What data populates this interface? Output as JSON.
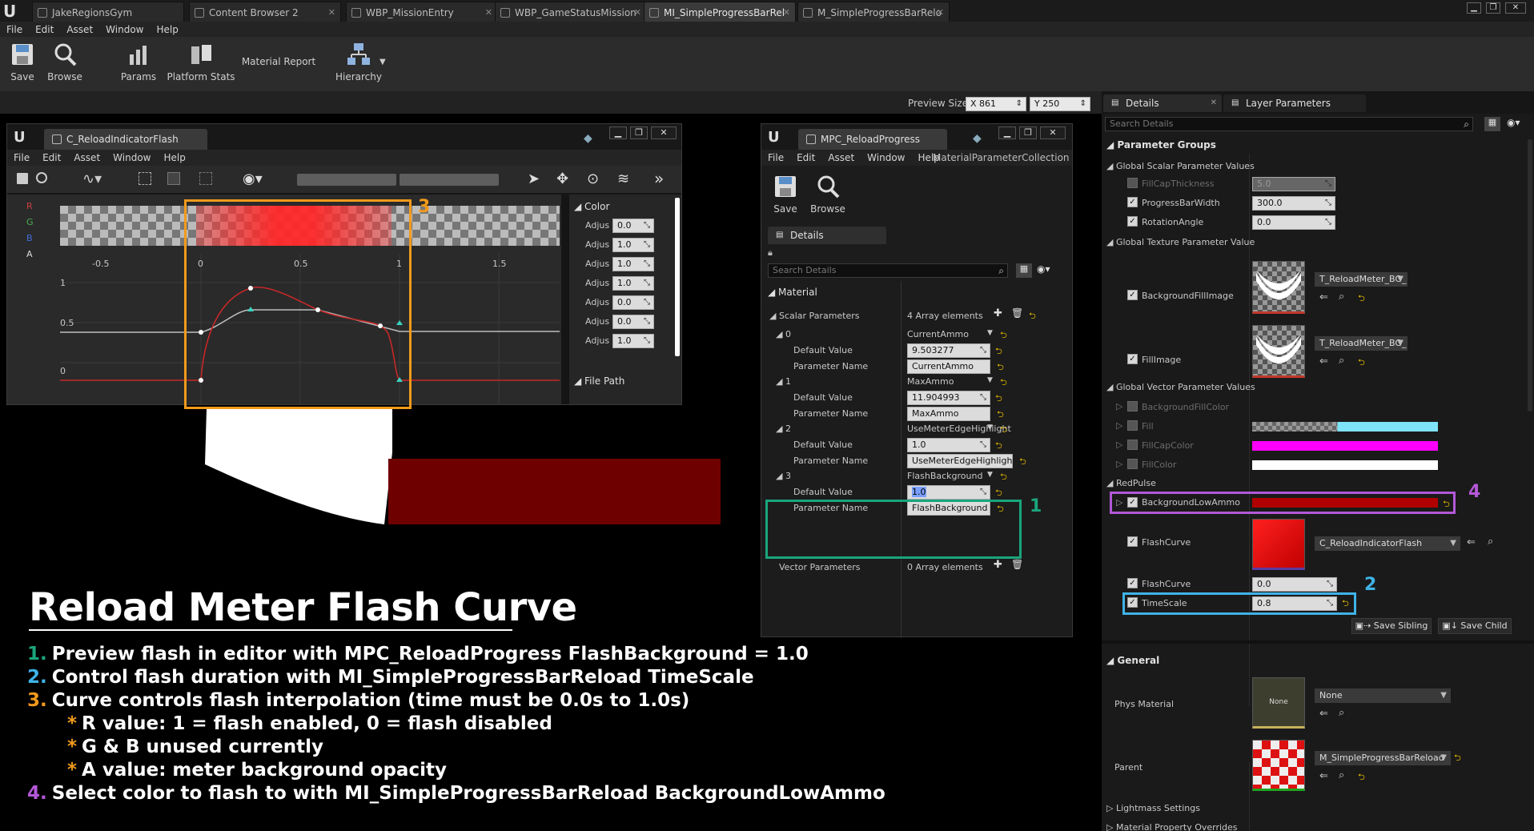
{
  "colors": {
    "teal": "#1aa57c",
    "blue": "#3fb3e8",
    "orange": "#f29a1c",
    "purple": "#b358d8"
  },
  "tabs": [
    {
      "label": "JakeRegionsGym"
    },
    {
      "label": "Content Browser 2"
    },
    {
      "label": "WBP_MissionEntry"
    },
    {
      "label": "WBP_GameStatusMission"
    },
    {
      "label": "MI_SimpleProgressBarRel"
    },
    {
      "label": "M_SimpleProgressBarRelo"
    }
  ],
  "menu": [
    "File",
    "Edit",
    "Asset",
    "Window",
    "Help"
  ],
  "toolbar": {
    "save": "Save",
    "browse": "Browse",
    "params": "Params",
    "platform_stats": "Platform Stats",
    "material_report": "Material Report",
    "hierarchy": "Hierarchy"
  },
  "preview": {
    "label": "Preview Size",
    "x_label": "X",
    "x": "861",
    "y_label": "Y",
    "y": "250"
  },
  "curve_window": {
    "tab": "C_ReloadIndicatorFlash",
    "menu": [
      "File",
      "Edit",
      "Asset",
      "Window",
      "Help"
    ],
    "channels": [
      "R",
      "G",
      "B",
      "A"
    ],
    "ticks": [
      "-0.5",
      "0",
      "0.5",
      "1",
      "1.5"
    ],
    "yticks": [
      "1",
      "0.5",
      "0"
    ],
    "color_header": "Color",
    "adjust_label": "Adjus",
    "adjust_values": [
      "0.0",
      "1.0",
      "1.0",
      "1.0",
      "0.0",
      "0.0",
      "1.0"
    ],
    "file_path": "File Path"
  },
  "mpc_window": {
    "tab": "MPC_ReloadProgress",
    "menu": [
      "File",
      "Edit",
      "Asset",
      "Window",
      "Help"
    ],
    "parent_class": "MaterialParameterCollection",
    "save": "Save",
    "browse": "Browse",
    "details_tab": "Details",
    "search_placeholder": "Search Details",
    "section": "Material",
    "scalar_label": "Scalar Parameters",
    "scalar_count": "4 Array elements",
    "params": [
      {
        "idx": "0",
        "name": "CurrentAmmo",
        "default": "9.503277",
        "pname": "CurrentAmmo"
      },
      {
        "idx": "1",
        "name": "MaxAmmo",
        "default": "11.904993",
        "pname": "MaxAmmo"
      },
      {
        "idx": "2",
        "name": "UseMeterEdgeHighlight",
        "default": "1.0",
        "pname": "UseMeterEdgeHighlight"
      },
      {
        "idx": "3",
        "name": "FlashBackground",
        "default": "1.0",
        "pname": "FlashBackground"
      }
    ],
    "default_label": "Default Value",
    "pname_label": "Parameter Name",
    "vector_label": "Vector Parameters",
    "vector_count": "0 Array elements"
  },
  "details": {
    "tab1": "Details",
    "tab2": "Layer Parameters",
    "search_placeholder": "Search Details",
    "param_groups": "Parameter Groups",
    "global_scalar": "Global Scalar Parameter Values",
    "scalars": [
      {
        "name": "FillCapThickness",
        "value": "5.0",
        "checked": false
      },
      {
        "name": "ProgressBarWidth",
        "value": "300.0",
        "checked": true
      },
      {
        "name": "RotationAngle",
        "value": "0.0",
        "checked": true
      }
    ],
    "global_texture": "Global Texture Parameter Value",
    "textures": [
      {
        "name": "BackgroundFillImage",
        "asset": "T_ReloadMeter_BG_I"
      },
      {
        "name": "FillImage",
        "asset": "T_ReloadMeter_BG_I"
      }
    ],
    "global_vector": "Global Vector Parameter Values",
    "vectors": [
      {
        "name": "BackgroundFillColor",
        "color": "#1a1a1a"
      },
      {
        "name": "Fill",
        "color": "#7fe3f7"
      },
      {
        "name": "FillCapColor",
        "color": "#ff00ff"
      },
      {
        "name": "FillColor",
        "color": "#ffffff"
      }
    ],
    "redpulse": "RedPulse",
    "bg_low_ammo": "BackgroundLowAmmo",
    "bg_low_ammo_color": "#b00000",
    "flashcurve_label": "FlashCurve",
    "flashcurve_asset": "C_ReloadIndicatorFlash",
    "flashcurve2_label": "FlashCurve",
    "flashcurve2_value": "0.0",
    "timescale_label": "TimeScale",
    "timescale_value": "0.8",
    "save_sibling": "Save Sibling",
    "save_child": "Save Child",
    "general": "General",
    "phys_material": "Phys Material",
    "phys_thumb": "None",
    "phys_value": "None",
    "parent": "Parent",
    "parent_value": "M_SimpleProgressBarReload",
    "lightmass": "Lightmass Settings",
    "mat_overrides": "Material Property Overrides"
  },
  "annotations": [
    "1",
    "2",
    "3",
    "4"
  ],
  "overlay": {
    "title": "Reload Meter Flash Curve",
    "lines": [
      {
        "num": "1.",
        "text": "Preview flash in editor with MPC_ReloadProgress FlashBackground = 1.0",
        "color": "#1aa57c"
      },
      {
        "num": "2.",
        "text": "Control flash duration with MI_SimpleProgressBarReload TimeScale",
        "color": "#3fb3e8"
      },
      {
        "num": "3.",
        "text": "Curve controls flash interpolation (time must be 0.0s to 1.0s)",
        "color": "#f29a1c"
      },
      {
        "num": "*",
        "text": "R value: 1 = flash enabled, 0 = flash disabled",
        "color": "#f29a1c"
      },
      {
        "num": "*",
        "text": "G & B unused currently",
        "color": "#f29a1c"
      },
      {
        "num": "*",
        "text": "A value: meter background opacity",
        "color": "#f29a1c"
      },
      {
        "num": "4.",
        "text": "Select color to flash to with MI_SimpleProgressBarReload BackgroundLowAmmo",
        "color": "#b358d8"
      }
    ]
  }
}
